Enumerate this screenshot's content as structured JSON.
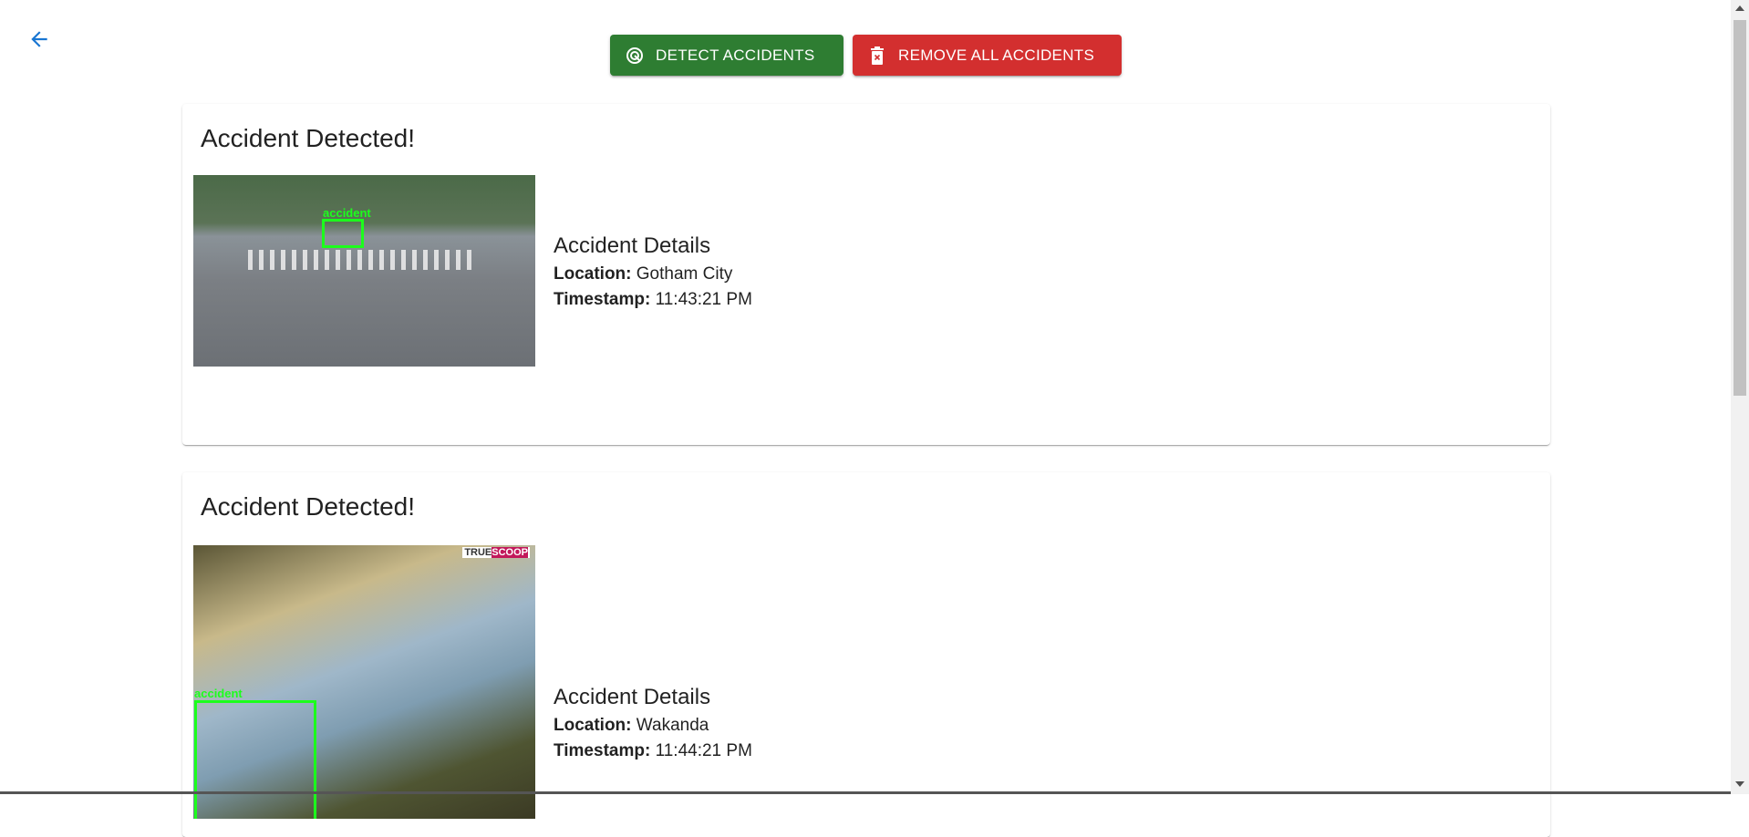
{
  "nav": {
    "back_icon": "arrow-left-icon"
  },
  "toolbar": {
    "detect_label": "DETECT ACCIDENTS",
    "detect_icon": "radar-icon",
    "detect_color": "#2e7d32",
    "remove_label": "REMOVE ALL ACCIDENTS",
    "remove_icon": "delete-forever-icon",
    "remove_color": "#d32f2f"
  },
  "accidents": [
    {
      "title": "Accident Detected!",
      "image_label": "accident",
      "details_heading": "Accident Details",
      "location_label": "Location:",
      "location": "Gotham City",
      "timestamp_label": "Timestamp:",
      "timestamp": "11:43:21 PM"
    },
    {
      "title": "Accident Detected!",
      "image_label": "accident",
      "image_watermark": "TRUESCOOP",
      "details_heading": "Accident Details",
      "location_label": "Location:",
      "location": "Wakanda",
      "timestamp_label": "Timestamp:",
      "timestamp": "11:44:21 PM"
    }
  ]
}
